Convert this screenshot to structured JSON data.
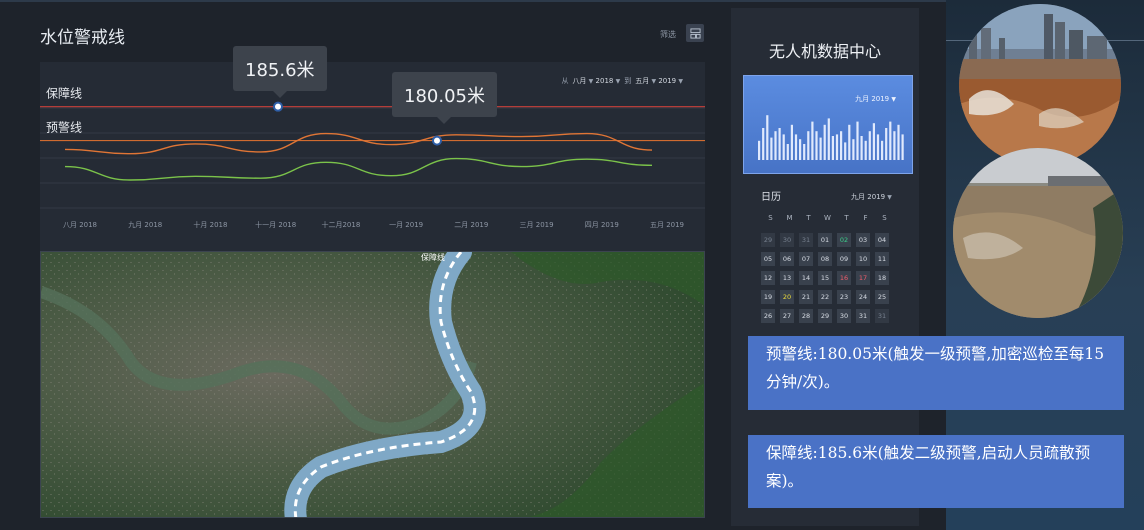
{
  "page": {
    "title": "水位警戒线",
    "filter_label": "筛选",
    "filter_icon": "layout-icon"
  },
  "chart": {
    "date_from_label": "从",
    "date_from_month": "八月",
    "date_from_year": "2018",
    "date_to_label": "到",
    "date_to_month": "五月",
    "date_to_year": "2019",
    "guarantee_label": "保障线",
    "warning_label": "预警线",
    "tooltip_guarantee": "185.6米",
    "tooltip_warning": "180.05米",
    "colors": {
      "guarantee": "#c9403a",
      "warning": "#d06b30",
      "orange_series": "#e07535",
      "green_series": "#7bc34a"
    }
  },
  "chart_data": {
    "type": "line",
    "x": [
      "八月 2018",
      "九月 2018",
      "十月 2018",
      "十一月 2018",
      "十二月2018",
      "一月 2019",
      "二月 2019",
      "三月 2019",
      "四月 2019",
      "五月 2019"
    ],
    "series": [
      {
        "values": [
          178.6,
          177.9,
          179.5,
          178.2,
          181.2,
          179.4,
          181.0,
          180.7,
          181.2,
          178.5
        ]
      },
      {
        "values": [
          175.8,
          173.6,
          174.2,
          173.9,
          176.5,
          174.3,
          177.1,
          175.8,
          177.0,
          176.0
        ]
      }
    ],
    "reference_lines": [
      {
        "name": "保障线",
        "value": 185.6
      },
      {
        "name": "预警线",
        "value": 180.05
      }
    ]
  },
  "map": {
    "label": "保障线"
  },
  "drone": {
    "title": "无人机数据中心",
    "month": "九月",
    "year": "2019",
    "bars": [
      12,
      20,
      28,
      14,
      18,
      20,
      16,
      10,
      22,
      16,
      13,
      10,
      18,
      24,
      18,
      14,
      22,
      26,
      15,
      16,
      18,
      11,
      22,
      13,
      24,
      15,
      12,
      18,
      23,
      16,
      12,
      20,
      24,
      18,
      22,
      16
    ]
  },
  "calendar": {
    "title": "日历",
    "month": "九月",
    "year": "2019",
    "weekdays": [
      "S",
      "M",
      "T",
      "W",
      "T",
      "F",
      "S"
    ],
    "rows": [
      [
        "29",
        "30",
        "31",
        "01",
        "02",
        "03",
        "04"
      ],
      [
        "05",
        "06",
        "07",
        "08",
        "09",
        "10",
        "11"
      ],
      [
        "12",
        "13",
        "14",
        "15",
        "16",
        "17",
        "18"
      ],
      [
        "19",
        "20",
        "21",
        "22",
        "23",
        "24",
        "25"
      ],
      [
        "26",
        "27",
        "28",
        "29",
        "30",
        "31",
        "31"
      ]
    ]
  },
  "notes": {
    "warning": "预警线:180.05米(触发一级预警,加密巡检至每15分钟/次)。",
    "guarantee": "保障线:185.6米(触发二级预警,启动人员疏散预案)。"
  }
}
